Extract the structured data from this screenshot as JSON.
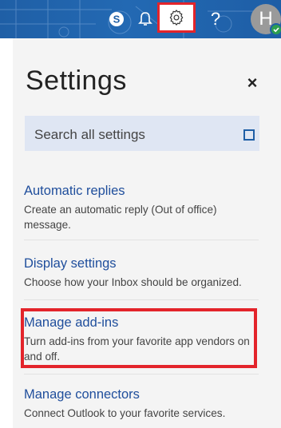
{
  "topbar": {
    "skype_icon": "skype-icon",
    "bell_icon": "bell-icon",
    "settings_icon": "gear-icon",
    "help_label": "?",
    "avatar_initial": "H"
  },
  "settings": {
    "title": "Settings",
    "close_label": "×",
    "search_placeholder": "Search all settings",
    "items": [
      {
        "title": "Automatic replies",
        "description": "Create an automatic reply (Out of office) message."
      },
      {
        "title": "Display settings",
        "description": "Choose how your Inbox should be organized."
      },
      {
        "title": "Manage add-ins",
        "description": "Turn add-ins from your favorite app vendors on and off."
      },
      {
        "title": "Manage connectors",
        "description": "Connect Outlook to your favorite services."
      }
    ]
  },
  "colors": {
    "topbar": "#1f5fa6",
    "accent_link": "#1f4e9c",
    "highlight": "#e3242b",
    "search_bg": "#dfe6f3",
    "presence": "#2e9e4f"
  }
}
